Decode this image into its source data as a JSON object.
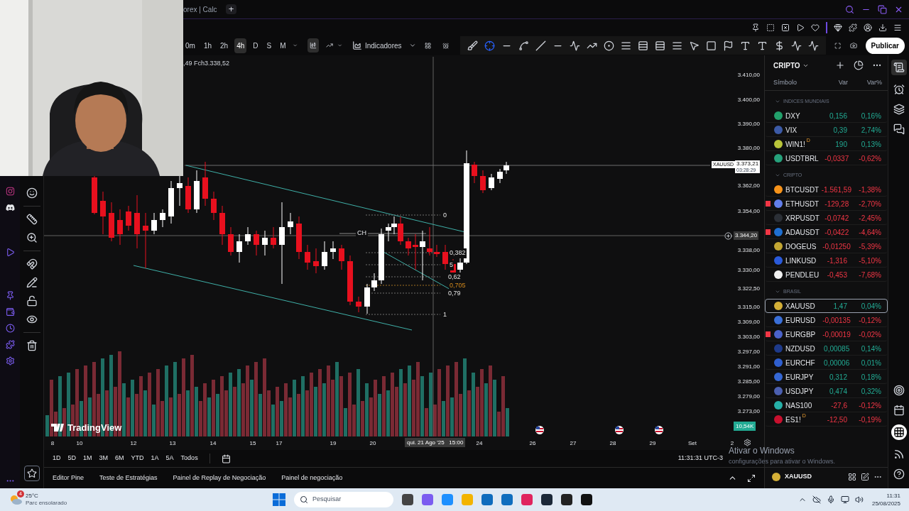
{
  "browser": {
    "tab_title": "orex | Calc",
    "new_tab": "+"
  },
  "toolbar": {
    "intervals": [
      {
        "label": "0m",
        "selected": false
      },
      {
        "label": "1h",
        "selected": false
      },
      {
        "label": "2h",
        "selected": false
      },
      {
        "label": "4h",
        "selected": true
      },
      {
        "label": "D",
        "selected": false
      },
      {
        "label": "S",
        "selected": false
      },
      {
        "label": "M",
        "selected": false
      }
    ],
    "indicators": "Indicadores",
    "publish": "Publicar"
  },
  "chart": {
    "ohlc": ",49 Fch3.338,52",
    "price_ticks": [
      "3.410,00",
      "3.400,00",
      "3.390,00",
      "3.380,00",
      "3.362,00",
      "3.354,00",
      "3.338,00",
      "3.330,00",
      "3.322,50",
      "3.315,00",
      "3.309,00",
      "3.303,00",
      "3.297,00",
      "3.291,00",
      "3.285,00",
      "3.279,00",
      "3.273,00"
    ],
    "time_labels": [
      "8",
      "10",
      "12",
      "13",
      "14",
      "15",
      "17",
      "19",
      "20",
      "24",
      "26",
      "27",
      "28",
      "29",
      "Set",
      "2"
    ],
    "crosshair_time": "qui. 21 Ago '25   15:00",
    "fib_levels": [
      {
        "label": "0",
        "highlight": false
      },
      {
        "label": "0,382",
        "highlight": false
      },
      {
        "label": "5",
        "highlight": false
      },
      {
        "label": "0,62",
        "highlight": false
      },
      {
        "label": "0,705",
        "highlight": true
      },
      {
        "label": "0,79",
        "highlight": false
      },
      {
        "label": "1",
        "highlight": false
      }
    ],
    "channel_label": "CH",
    "last_price": {
      "symbol": "XAUUSD",
      "price": "3.373,21",
      "countdown": "03:28:29"
    },
    "crosshair_price": "3.344,20",
    "volume_tag": "10,54K",
    "logo": "TradingView"
  },
  "ranges": [
    "1D",
    "5D",
    "1M",
    "3M",
    "6M",
    "YTD",
    "1A",
    "5A",
    "Todos"
  ],
  "clock": "11:31:31 UTC-3",
  "bottom_tabs": [
    "Editor Pine",
    "Teste de Estratégias",
    "Painel de Replay de Negociação",
    "Painel de negociação"
  ],
  "watchlist": {
    "title": "CRIPTO",
    "columns": [
      "Símbolo",
      "Var",
      "Var%"
    ],
    "sections": [
      {
        "name": "INDICES MUNDIAIS",
        "rows": [
          {
            "symbol": "DXY",
            "var": "0,156",
            "pct": "0,16%",
            "up": true,
            "flagged": false,
            "selected": false,
            "color": "#22a06b"
          },
          {
            "symbol": "VIX",
            "var": "0,39",
            "pct": "2,74%",
            "up": true,
            "flagged": false,
            "selected": false,
            "color": "#3c5aa6"
          },
          {
            "symbol": "WIN1!",
            "badge": "D",
            "var": "190",
            "pct": "0,13%",
            "up": true,
            "flagged": false,
            "selected": false,
            "color": "#b8c43a"
          },
          {
            "symbol": "USDTBRL",
            "var": "-0,0337",
            "pct": "-0,62%",
            "up": false,
            "flagged": false,
            "selected": false,
            "color": "#26a17b"
          }
        ]
      },
      {
        "name": "CRIPTO",
        "rows": [
          {
            "symbol": "BTCUSDT",
            "var": "-1.561,59",
            "pct": "-1,38%",
            "up": false,
            "flagged": false,
            "selected": false,
            "color": "#f7931a"
          },
          {
            "symbol": "ETHUSDT",
            "var": "-129,28",
            "pct": "-2,70%",
            "up": false,
            "flagged": true,
            "selected": false,
            "color": "#627eea"
          },
          {
            "symbol": "XRPUSDT",
            "var": "-0,0742",
            "pct": "-2,45%",
            "up": false,
            "flagged": false,
            "selected": false,
            "color": "#2b2f36"
          },
          {
            "symbol": "ADAUSDT",
            "var": "-0,0422",
            "pct": "-4,64%",
            "up": false,
            "flagged": true,
            "selected": false,
            "color": "#1f6fd1"
          },
          {
            "symbol": "DOGEUS",
            "var": "-0,01250",
            "pct": "-5,39%",
            "up": false,
            "flagged": false,
            "selected": false,
            "color": "#c2a633"
          },
          {
            "symbol": "LINKUSD",
            "var": "-1,316",
            "pct": "-5,10%",
            "up": false,
            "flagged": false,
            "selected": false,
            "color": "#2a5ada"
          },
          {
            "symbol": "PENDLEU",
            "var": "-0,453",
            "pct": "-7,68%",
            "up": false,
            "flagged": false,
            "selected": false,
            "color": "#f0f0f0"
          }
        ]
      },
      {
        "name": "BRASIL",
        "rows": [
          {
            "symbol": "XAUUSD",
            "var": "1,47",
            "pct": "0,04%",
            "up": true,
            "flagged": false,
            "selected": true,
            "color": "#d4af37"
          },
          {
            "symbol": "EURUSD",
            "var": "-0,00135",
            "pct": "-0,12%",
            "up": false,
            "flagged": false,
            "selected": false,
            "color": "#3a6fd8"
          },
          {
            "symbol": "EURGBP",
            "var": "-0,00019",
            "pct": "-0,02%",
            "up": false,
            "flagged": true,
            "selected": false,
            "color": "#4a62c9"
          },
          {
            "symbol": "NZDUSD",
            "var": "0,00085",
            "pct": "0,14%",
            "up": true,
            "flagged": false,
            "selected": false,
            "color": "#1e3a8a"
          },
          {
            "symbol": "EURCHF",
            "var": "0,00006",
            "pct": "0,01%",
            "up": true,
            "flagged": false,
            "selected": false,
            "color": "#2f5fcf"
          },
          {
            "symbol": "EURJPY",
            "var": "0,312",
            "pct": "0,18%",
            "up": true,
            "flagged": false,
            "selected": false,
            "color": "#3567d4"
          },
          {
            "symbol": "USDJPY",
            "var": "0,474",
            "pct": "0,32%",
            "up": true,
            "flagged": false,
            "selected": false,
            "color": "#4b5fb0"
          },
          {
            "symbol": "NAS100",
            "var": "-27,6",
            "pct": "-0,12%",
            "up": false,
            "flagged": false,
            "selected": false,
            "color": "#26b0a8"
          },
          {
            "symbol": "ES1!",
            "badge": "D",
            "var": "-12,50",
            "pct": "-0,19%",
            "up": false,
            "flagged": false,
            "selected": false,
            "color": "#c8102e"
          }
        ]
      }
    ],
    "footer_symbol": "XAUUSD"
  },
  "windows_notice": {
    "title": "Ativar o Windows",
    "text": "configurações para ativar o Windows."
  },
  "taskbar": {
    "weather_badge": "4",
    "temperature": "25°C",
    "weather": "Parc ensolarado",
    "search_placeholder": "Pesquisar",
    "time": "11:31",
    "date": "25/08/2025"
  }
}
